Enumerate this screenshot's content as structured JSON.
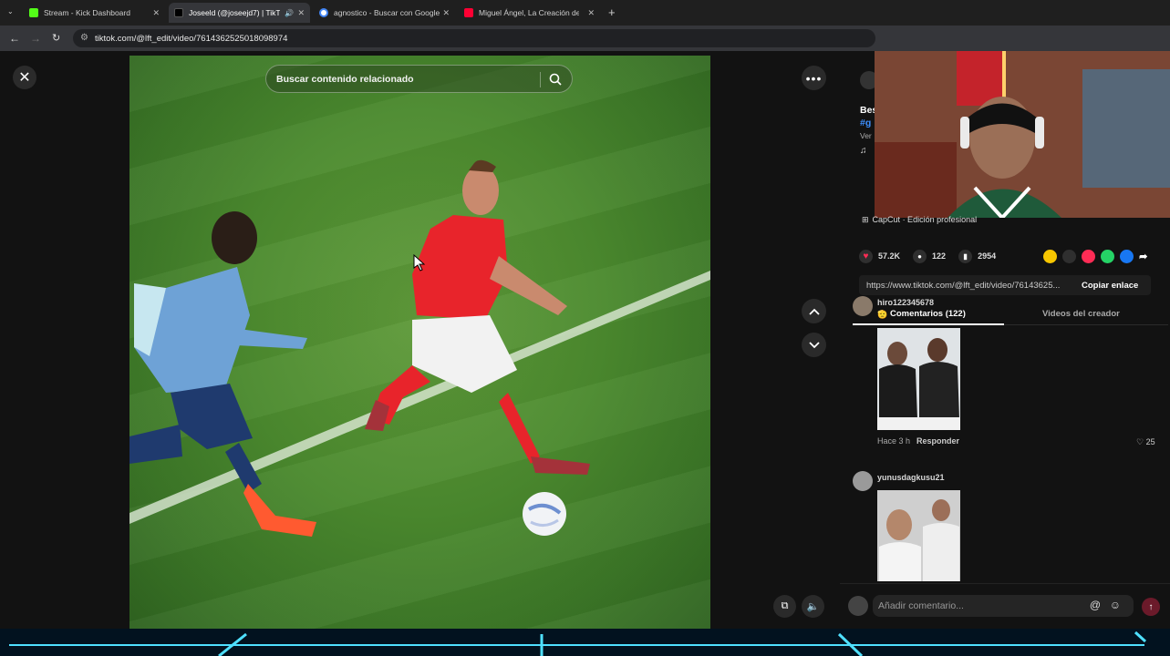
{
  "browser": {
    "tabs": [
      {
        "title": "Stream - Kick Dashboard",
        "active": false,
        "color": "#53fc18"
      },
      {
        "title": "Joseeld (@joseejd7) | TikTok",
        "active": true,
        "color": "#000000"
      },
      {
        "title": "agnostico - Buscar con Google",
        "active": false,
        "color": "#4285f4"
      },
      {
        "title": "Miguel Ángel, La Creación de Adán",
        "active": false,
        "color": "#ff0033"
      }
    ],
    "url": "tiktok.com/@lft_edit/video/7614362525018098974"
  },
  "video": {
    "search_placeholder": "Buscar contenido relacionado"
  },
  "panel": {
    "caption_fragments": [
      "Bes",
      "#g",
      "Ver"
    ],
    "music_label": "CapCut · Edición profesional",
    "likes": "57.2K",
    "comments": "122",
    "saves": "2954",
    "share_icons": [
      "coin-icon",
      "embed-icon",
      "send-icon",
      "whatsapp-icon",
      "facebook-icon",
      "share-arrow-icon"
    ],
    "link": "https://www.tiktok.com/@lft_edit/video/76143625...",
    "copy_label": "Copiar enlace",
    "tabs": [
      "Comentarios (122)",
      "Videos del creador"
    ],
    "comment_list": [
      {
        "user": "hiro122345678",
        "emoji": "🫡",
        "time": "Hace 3 h",
        "reply": "Responder",
        "likes": "25"
      },
      {
        "user": "yunusdagkusu21"
      }
    ],
    "comment_placeholder": "Añadir comentario..."
  }
}
